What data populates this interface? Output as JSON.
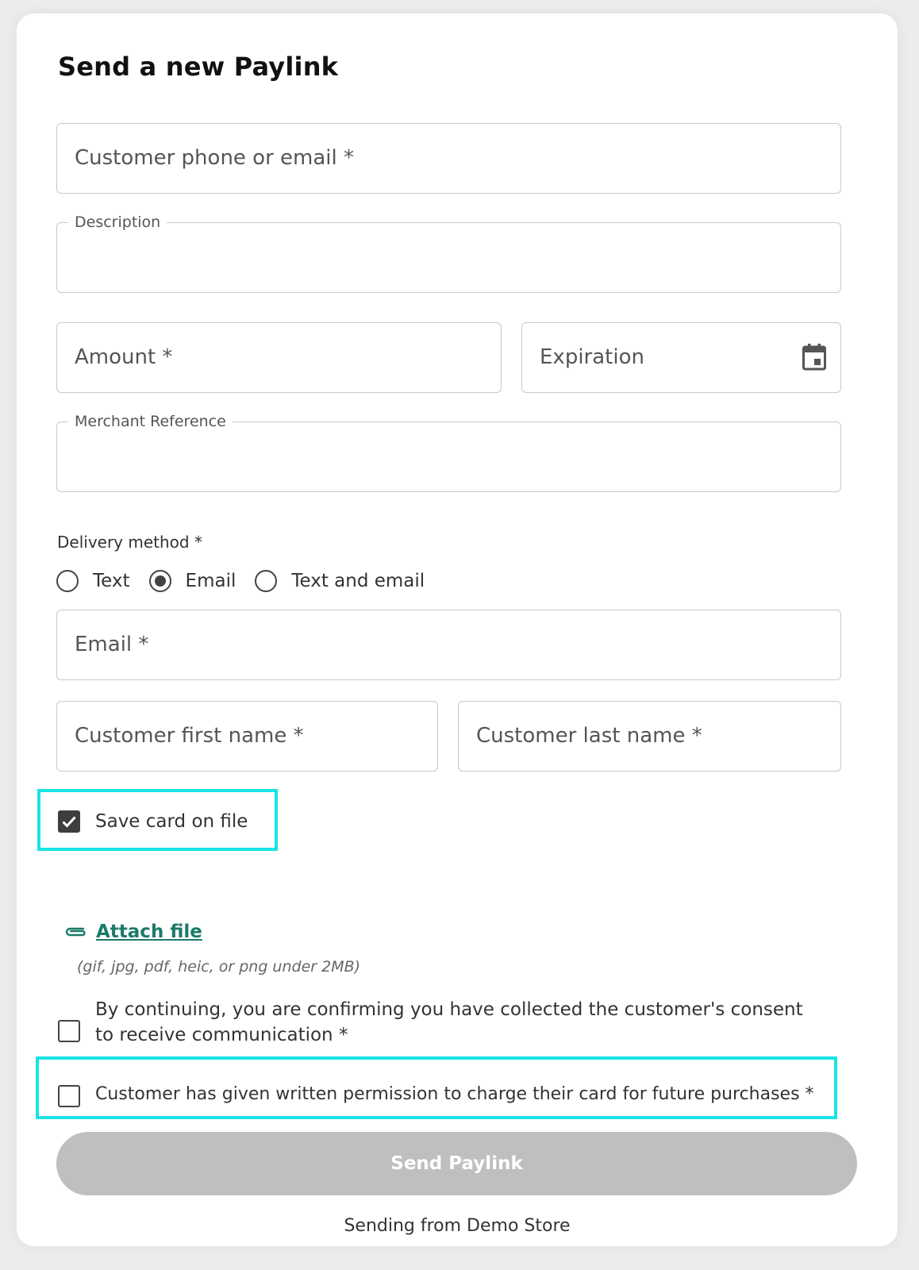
{
  "title": "Send a new Paylink",
  "fields": {
    "contact": {
      "placeholder": "Customer phone or email *"
    },
    "description": {
      "label": "Description"
    },
    "amount": {
      "placeholder": "Amount *"
    },
    "expiration": {
      "placeholder": "Expiration",
      "icon": "calendar-icon"
    },
    "merchant_reference": {
      "label": "Merchant Reference"
    },
    "email": {
      "placeholder": "Email *"
    },
    "first_name": {
      "placeholder": "Customer first name *"
    },
    "last_name": {
      "placeholder": "Customer last name *"
    }
  },
  "delivery": {
    "label": "Delivery method *",
    "options": [
      "Text",
      "Email",
      "Text and email"
    ],
    "selected": "Email"
  },
  "save_card": {
    "label": "Save card on file",
    "checked": true
  },
  "attach": {
    "label": "Attach file",
    "icon": "paperclip-icon",
    "hint": "(gif, jpg, pdf, heic, or png under 2MB)"
  },
  "consent": {
    "label": "By continuing, you are confirming you have collected the customer's consent to receive communication *",
    "checked": false
  },
  "permission": {
    "label": "Customer has given written permission to charge their card for future purchases *",
    "checked": false
  },
  "submit": {
    "label": "Send Paylink"
  },
  "footer": "Sending from Demo Store",
  "colors": {
    "highlight": "#19e3e6",
    "link": "#1c7a6a",
    "button_disabled": "#bfbfbf"
  }
}
